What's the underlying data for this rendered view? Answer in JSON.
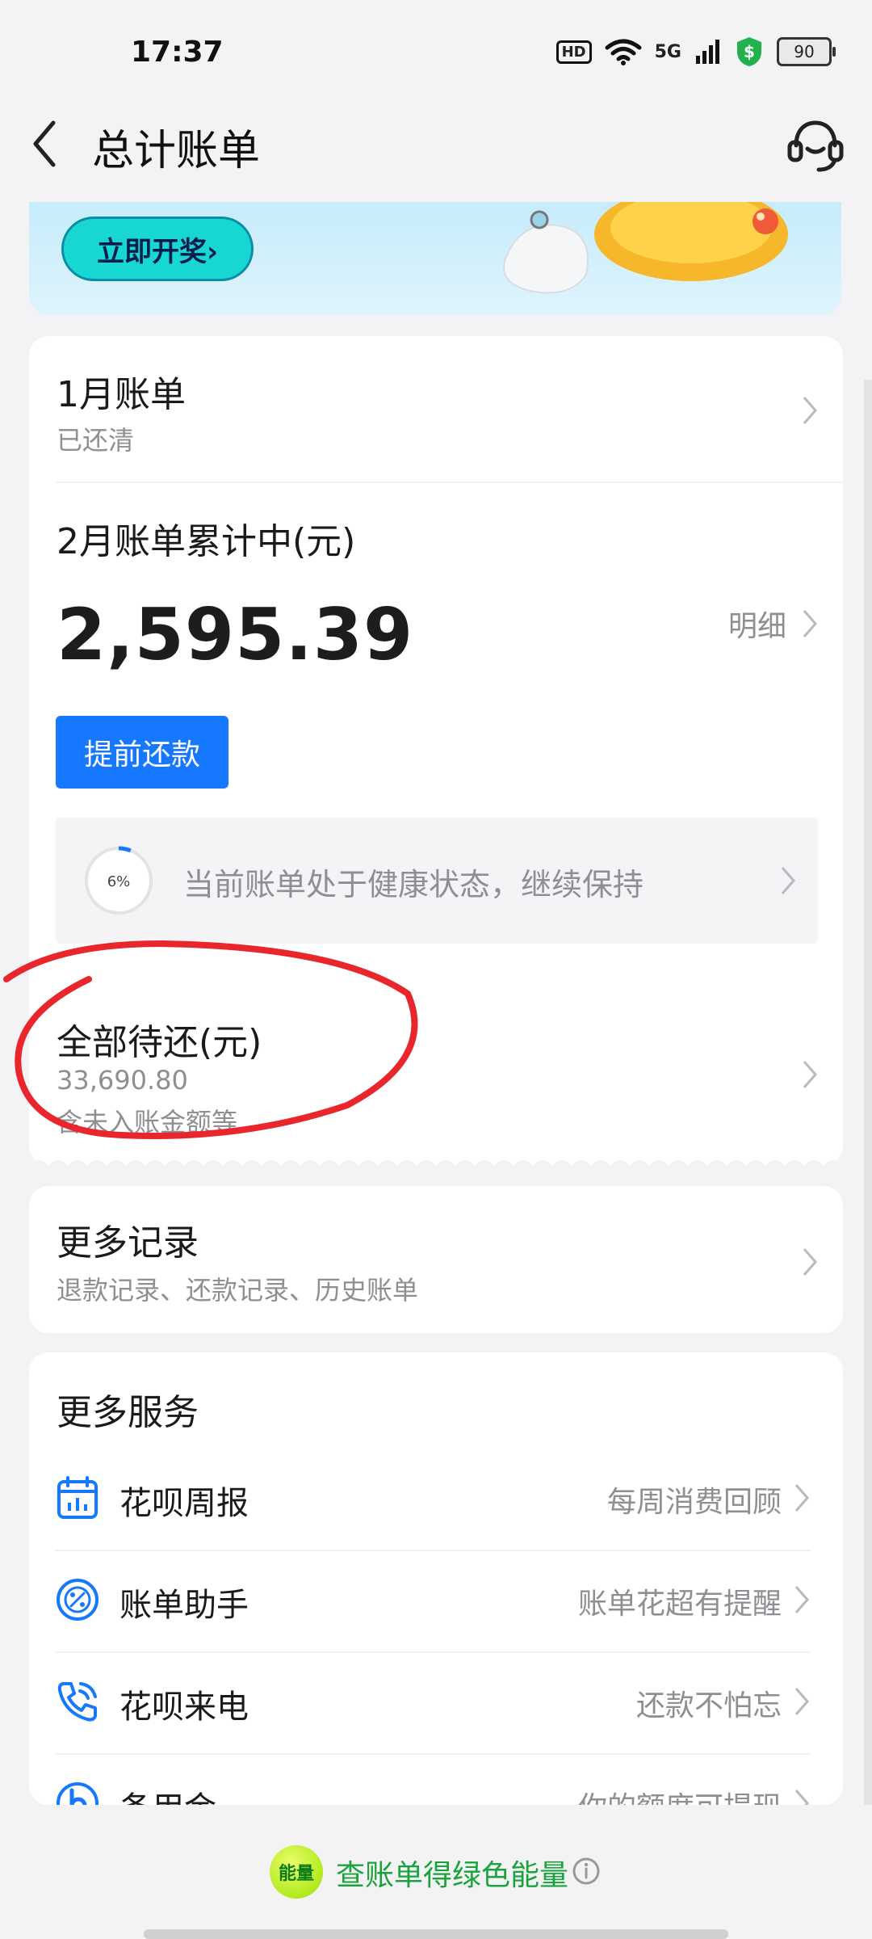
{
  "status_bar": {
    "time": "17:37",
    "hd": "HD",
    "network": "5G",
    "battery": "90"
  },
  "header": {
    "title": "总计账单"
  },
  "banner": {
    "button_label": "立即开奖›"
  },
  "bills": {
    "jan": {
      "title": "1月账单",
      "status": "已还清"
    },
    "feb": {
      "title": "2月账单累计中(元)",
      "amount": "2,595.39",
      "detail_label": "明细",
      "repay_button": "提前还款",
      "health_percent": "6%",
      "health_percent_value": 6,
      "health_text": "当前账单处于健康状态，继续保持"
    },
    "total": {
      "title": "全部待还(元)",
      "amount": "33,690.80",
      "note": "含未入账金额等"
    }
  },
  "more_records": {
    "title": "更多记录",
    "subtitle": "退款记录、还款记录、历史账单"
  },
  "more_services": {
    "title": "更多服务",
    "items": [
      {
        "label": "花呗周报",
        "hint": "每周消费回顾",
        "icon": "calendar-chart-icon"
      },
      {
        "label": "账单助手",
        "hint": "账单花超有提醒",
        "icon": "percent-gauge-icon"
      },
      {
        "label": "花呗来电",
        "hint": "还款不怕忘",
        "icon": "phone-call-icon"
      },
      {
        "label": "备用金",
        "hint": "你的额度可提现",
        "icon": "reserve-fund-icon"
      }
    ]
  },
  "footer": {
    "badge": "能量",
    "text": "查账单得绿色能量"
  },
  "colors": {
    "primary": "#1677ff",
    "energy_green": "#1aa33a",
    "annotation_red": "#e8262b"
  }
}
